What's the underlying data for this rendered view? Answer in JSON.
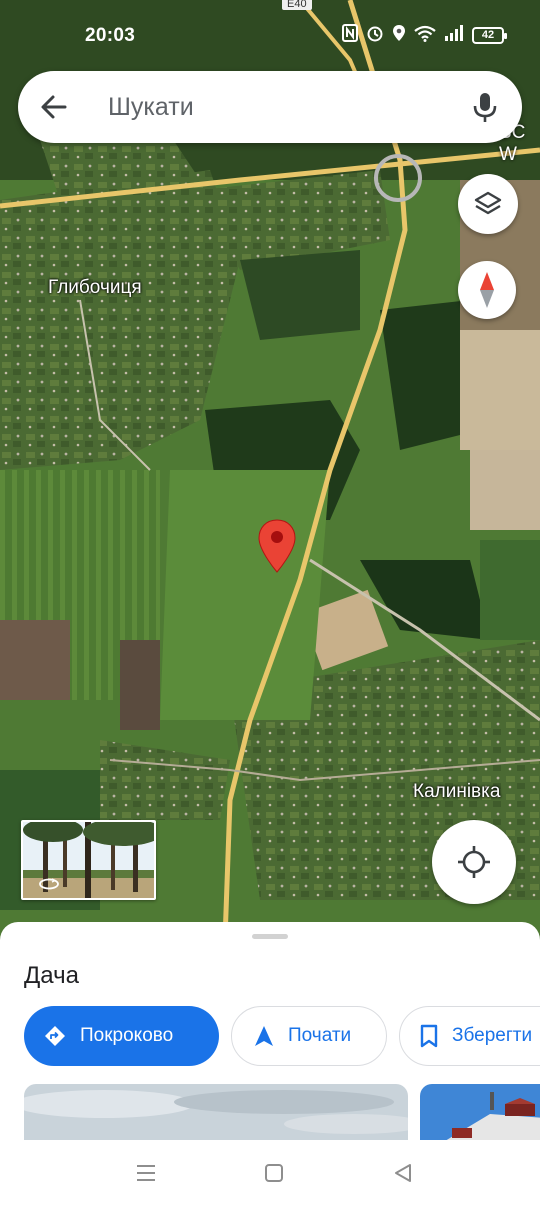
{
  "status_bar": {
    "time": "20:03",
    "battery": "42"
  },
  "search": {
    "placeholder": "Шукати"
  },
  "map": {
    "labels": {
      "highway": "E40",
      "road_partial": "BC W",
      "village_1": "Глибочиця",
      "village_2": "Калинівка"
    },
    "colors": {
      "pin": "#ea4335",
      "road": "#e8c66a"
    }
  },
  "place_sheet": {
    "title": "Дача",
    "buttons": {
      "directions": "Покроково",
      "start": "Почати",
      "save": "Зберегти"
    },
    "accent": "#1a73e8"
  }
}
